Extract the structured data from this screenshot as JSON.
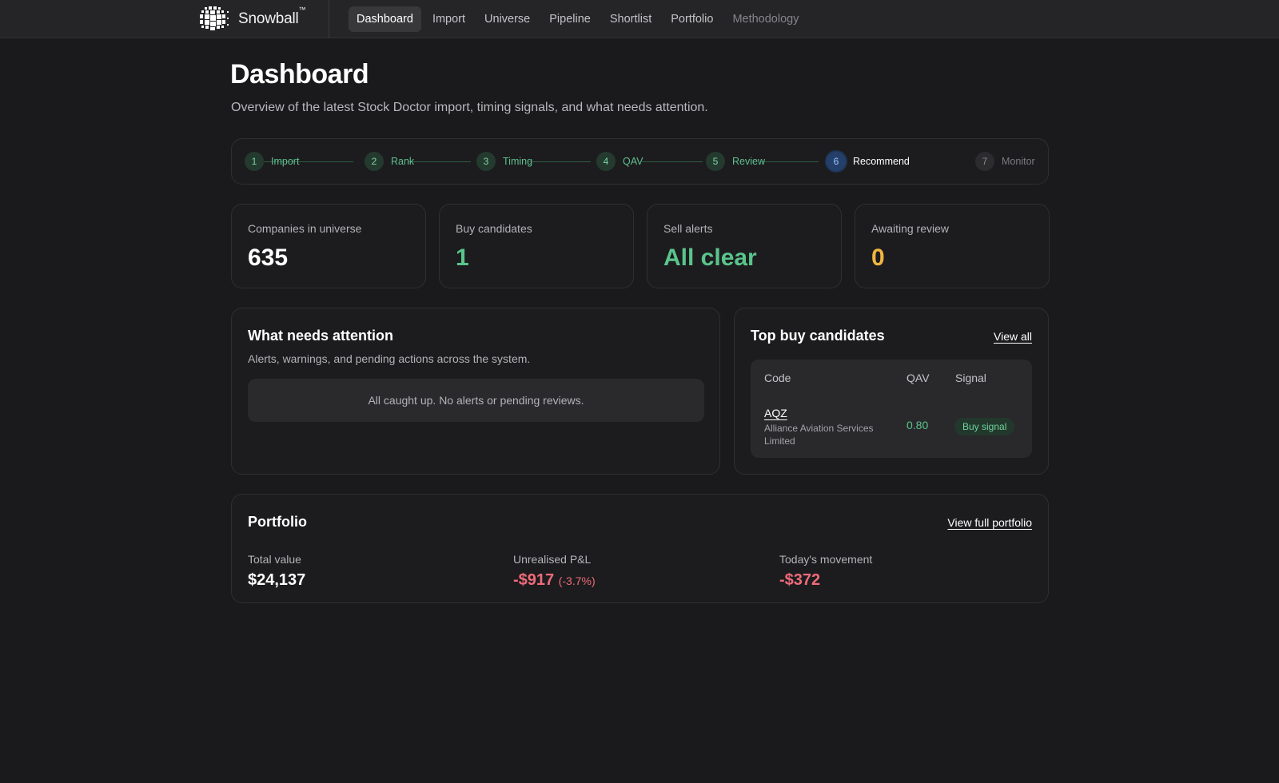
{
  "nav": {
    "brand": "Snowball",
    "brand_tm": "™",
    "items": [
      {
        "label": "Dashboard",
        "active": true
      },
      {
        "label": "Import"
      },
      {
        "label": "Universe"
      },
      {
        "label": "Pipeline"
      },
      {
        "label": "Shortlist"
      },
      {
        "label": "Portfolio"
      },
      {
        "label": "Methodology",
        "muted": true
      }
    ]
  },
  "page": {
    "title": "Dashboard",
    "subtitle": "Overview of the latest Stock Doctor import, timing signals, and what needs attention."
  },
  "stepper": {
    "steps": [
      {
        "num": "1",
        "label": "Import",
        "state": "done"
      },
      {
        "num": "2",
        "label": "Rank",
        "state": "done"
      },
      {
        "num": "3",
        "label": "Timing",
        "state": "done"
      },
      {
        "num": "4",
        "label": "QAV",
        "state": "done"
      },
      {
        "num": "5",
        "label": "Review",
        "state": "done"
      },
      {
        "num": "6",
        "label": "Recommend",
        "state": "current"
      },
      {
        "num": "7",
        "label": "Monitor",
        "state": "future"
      }
    ]
  },
  "stats": [
    {
      "label": "Companies in universe",
      "value": "635"
    },
    {
      "label": "Buy candidates",
      "value": "1"
    },
    {
      "label": "Sell alerts",
      "value": "All clear"
    },
    {
      "label": "Awaiting review",
      "value": "0"
    }
  ],
  "attention": {
    "title": "What needs attention",
    "subtitle": "Alerts, warnings, and pending actions across the system.",
    "empty": "All caught up. No alerts or pending reviews."
  },
  "candidates": {
    "title": "Top buy candidates",
    "view_all": "View all",
    "columns": [
      "Code",
      "QAV",
      "Signal"
    ],
    "rows": [
      {
        "code": "AQZ",
        "company": "Alliance Aviation Services Limited",
        "qav": "0.80",
        "signal": "Buy signal"
      }
    ]
  },
  "portfolio": {
    "title": "Portfolio",
    "view_full": "View full portfolio",
    "total_label": "Total value",
    "total_value": "$24,137",
    "pnl_label": "Unrealised P&L",
    "pnl_value": "-$917",
    "pnl_pct": "(-3.7%)",
    "today_label": "Today's movement",
    "today_value": "-$372"
  },
  "colors": {
    "positive": "#5ac48c",
    "warning": "#f0b540",
    "negative": "#ef6b7a",
    "current_step": "#24406a"
  }
}
